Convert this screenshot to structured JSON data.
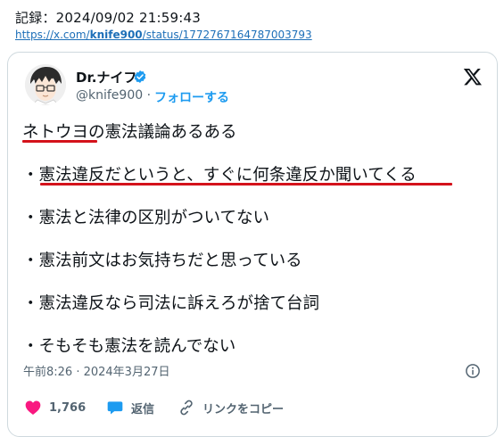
{
  "header": {
    "record_label": "記録：2024/09/02 21:59:43",
    "url_prefix": "https://x.com/",
    "url_bold": "knife900",
    "url_suffix": "/status/1772767164787003793"
  },
  "tweet": {
    "display_name": "Dr.ナイフ",
    "handle": "@knife900",
    "separator": "·",
    "follow_label": "フォローする",
    "lines": [
      "ネトウヨの憲法議論あるある",
      "・憲法違反だというと、すぐに何条違反か聞いてくる",
      "・憲法と法律の区別がついてない",
      "・憲法前文はお気持ちだと思っている",
      "・憲法違反なら司法に訴えろが捨て台詞",
      "・そもそも憲法を読んでない"
    ],
    "timestamp": "午前8:26 · 2024年3月27日",
    "likes": "1,766",
    "reply_label": "返信",
    "copy_link_label": "リンクをコピー"
  },
  "colors": {
    "like": "#f91880",
    "reply": "#1d9bf0",
    "verified": "#1d9bf0",
    "underline": "#d4121b"
  },
  "icons": [
    "verified-badge-icon",
    "x-logo-icon",
    "info-icon",
    "heart-icon",
    "reply-bubble-icon",
    "link-icon"
  ]
}
